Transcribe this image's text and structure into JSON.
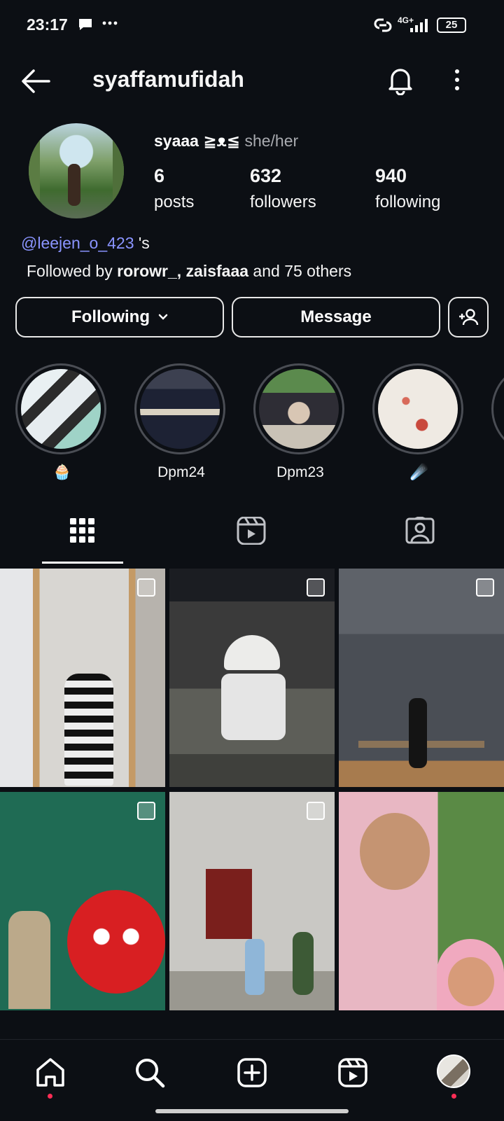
{
  "status_bar": {
    "time": "23:17",
    "network": "4G+",
    "battery": "25"
  },
  "header": {
    "username": "syaffamufidah"
  },
  "profile": {
    "display_name": "syaaa ≧ᴥ≦",
    "pronouns": "she/her",
    "stats": [
      {
        "value": "6",
        "label": "posts"
      },
      {
        "value": "632",
        "label": "followers"
      },
      {
        "value": "940",
        "label": "following"
      }
    ],
    "mention_link": "@leejen_o_423",
    "mention_suffix": " 's",
    "followed_by_prefix": "Followed by ",
    "followed_by_names": "rorowr_, zaisfaaa",
    "followed_by_suffix": " and 75 others"
  },
  "buttons": {
    "following": "Following",
    "message": "Message"
  },
  "highlights": [
    {
      "label": "🧁"
    },
    {
      "label": "Dpm24"
    },
    {
      "label": "Dpm23"
    },
    {
      "label": "☄️"
    }
  ],
  "colors": {
    "background": "#0c0f14",
    "link": "#8a94ff",
    "notification_dot": "#ff2d55"
  }
}
